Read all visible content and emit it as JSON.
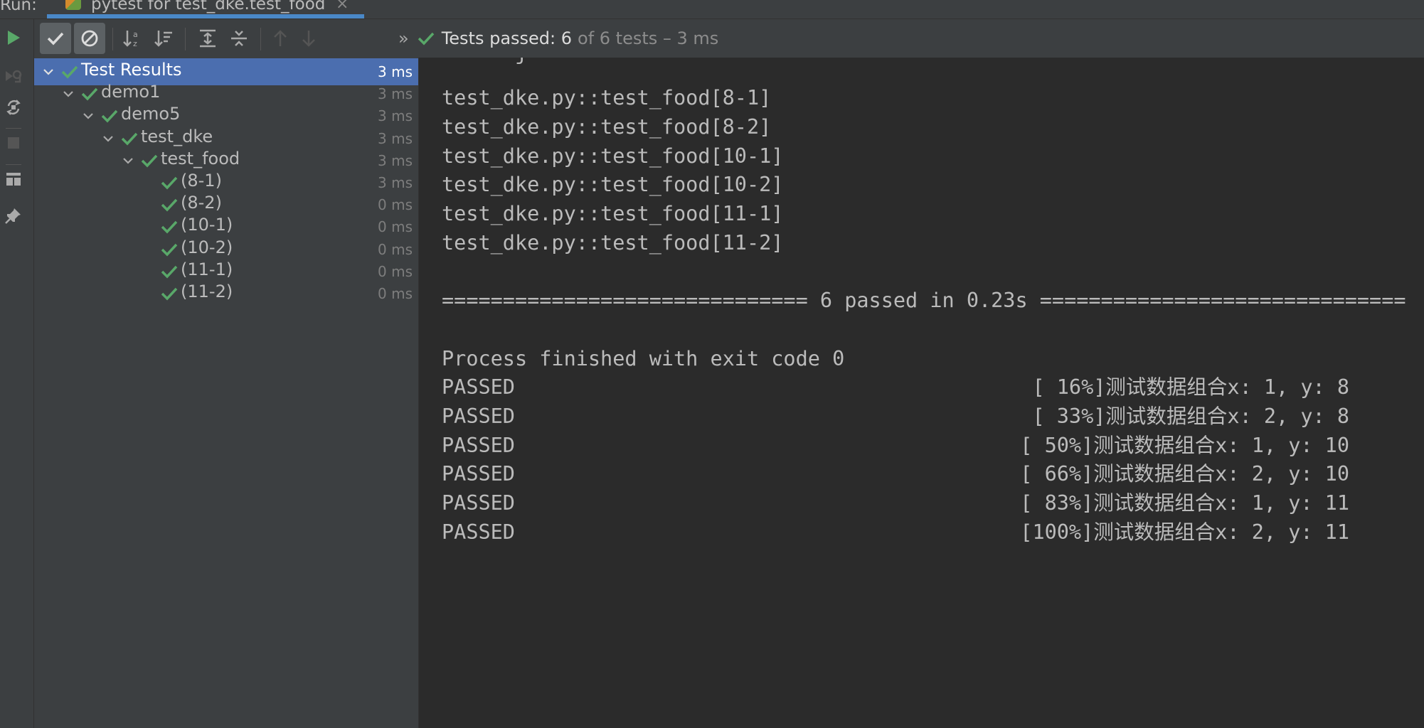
{
  "runbar": {
    "label": "Run:",
    "tab_title": "pytest for test_dke.test_food",
    "close_glyph": "×"
  },
  "toolbar": {
    "more_glyph": "»"
  },
  "status": {
    "passed_text": "Tests passed: 6",
    "rest_text": "of 6 tests – 3 ms"
  },
  "tree": {
    "items": [
      {
        "label": "Test Results",
        "time": "3 ms"
      },
      {
        "label": "demo1",
        "time": "3 ms"
      },
      {
        "label": "demo5",
        "time": "3 ms"
      },
      {
        "label": "test_dke",
        "time": "3 ms"
      },
      {
        "label": "test_food",
        "time": "3 ms"
      },
      {
        "label": "(8-1)",
        "time": "3 ms"
      },
      {
        "label": "(8-2)",
        "time": "0 ms"
      },
      {
        "label": "(10-1)",
        "time": "0 ms"
      },
      {
        "label": "(10-2)",
        "time": "0 ms"
      },
      {
        "label": "(11-1)",
        "time": "0 ms"
      },
      {
        "label": "(11-2)",
        "time": "0 ms"
      }
    ]
  },
  "console": {
    "partial_top": "      j",
    "tests": [
      "test_dke.py::test_food[8-1]",
      "test_dke.py::test_food[8-2]",
      "test_dke.py::test_food[10-1]",
      "test_dke.py::test_food[10-2]",
      "test_dke.py::test_food[11-1]",
      "test_dke.py::test_food[11-2]"
    ],
    "summary": "============================== 6 passed in 0.23s ==============================",
    "finish": "Process finished with exit code 0",
    "results": [
      {
        "status": "PASSED",
        "detail": "[ 16%]测试数据组合x: 1, y: 8"
      },
      {
        "status": "PASSED",
        "detail": "[ 33%]测试数据组合x: 2, y: 8"
      },
      {
        "status": "PASSED",
        "detail": "[ 50%]测试数据组合x: 1, y: 10"
      },
      {
        "status": "PASSED",
        "detail": "[ 66%]测试数据组合x: 2, y: 10"
      },
      {
        "status": "PASSED",
        "detail": "[ 83%]测试数据组合x: 1, y: 11"
      },
      {
        "status": "PASSED",
        "detail": "[100%]测试数据组合x: 2, y: 11"
      }
    ]
  },
  "colors": {
    "pass_green": "#59a869",
    "selection_blue": "#4b6eaf",
    "panel_bg": "#3c3f41",
    "console_bg": "#2b2b2b"
  }
}
